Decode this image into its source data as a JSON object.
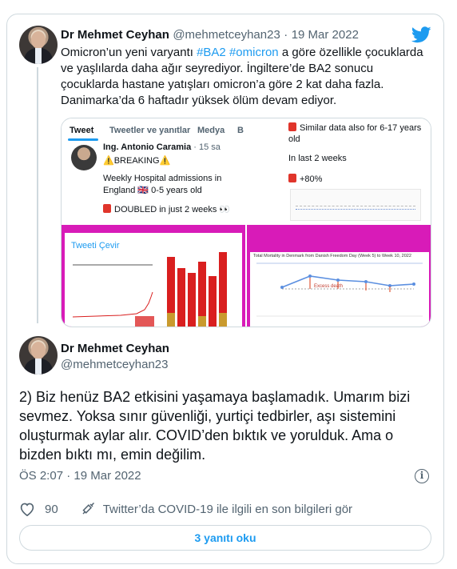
{
  "tweet1": {
    "name": "Dr Mehmet Ceyhan",
    "handle": "@mehmetceyhan23",
    "separator": "·",
    "date": "19 Mar 2022",
    "text_part1": "Omicron’un yeni varyantı ",
    "hashtag1": "#BA2",
    "hashtag2": "#omicron",
    "text_part2": " a göre özellikle çocuklarda ve yaşlılarda daha ağır seyrediyor. İngiltere’de BA2 sonucu çocuklarda hastane yatışları omicron’a göre 2 kat daha fazla. Danimarka’da 6 haftadır yüksek ölüm devam ediyor."
  },
  "media": {
    "tab_tweet": "Tweet",
    "tab_replies": "Tweetler ve yanıtlar",
    "tab_media": "Medya",
    "tab_b": "B",
    "quoted_name": "Ing. Antonio Caramia",
    "quoted_time": "· 15 sa",
    "breaking": "⚠️BREAKING⚠️",
    "weekly": "Weekly Hospital admissions in",
    "england": "England 🇬🇧 0-5 years old",
    "doubled": "DOUBLED in just 2 weeks 👀",
    "similar": "Similar data also for 6-17 years old",
    "last2": "In last 2 weeks",
    "plus80": "+80%",
    "translate": "Tweeti Çevir",
    "denmark_title": "Total Mortality in Denmark from Danish Freedom Day (Week 5) to Week 10, 2022",
    "excess": "Excess death"
  },
  "tweet2": {
    "name": "Dr Mehmet Ceyhan",
    "handle": "@mehmetceyhan23",
    "text": "2) Biz henüz BA2 etkisini yaşamaya başlamadık. Umarım bizi sevmez. Yoksa sınır güvenliği, yurtiçi tedbirler, aşı sistemini oluşturmak aylar alır. COVID’den bıktık ve yorulduk. Ama o bizden bıktı mı, emin değilim.",
    "time": "ÖS 2:07",
    "date": "19 Mar 2022",
    "info": "i",
    "likes": "90",
    "covid_link": "Twitter’da COVID-19 ile ilgili en son bilgileri gör",
    "replies_button": "3 yanıtı oku"
  },
  "colors": {
    "accent": "#1d9bf0",
    "magenta": "#d81bb8",
    "bar_red": "#d91f1f",
    "bar_gold": "#c99a2e"
  }
}
